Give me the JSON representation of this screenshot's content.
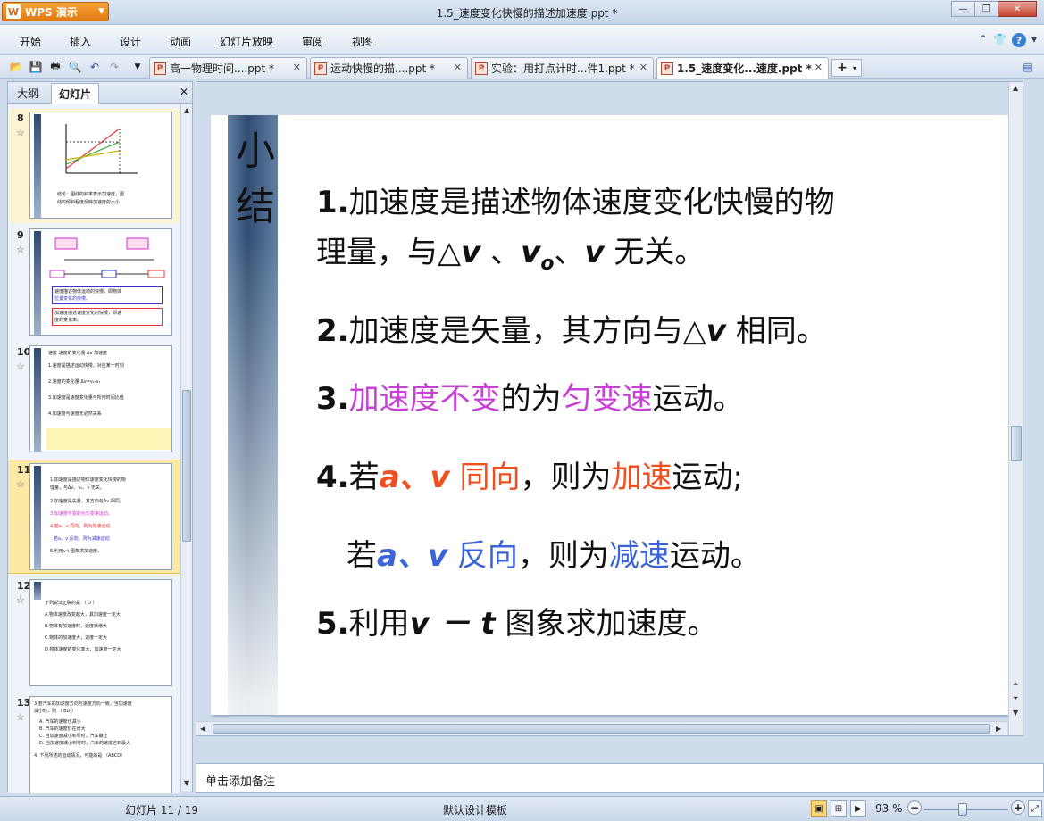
{
  "window": {
    "app_button": "WPS 演示",
    "app_logo": "W",
    "title": "1.5_速度变化快慢的描述加速度.ppt *",
    "controls": [
      "minimize-icon",
      "restore-icon",
      "close-icon"
    ]
  },
  "menu": [
    "开始",
    "插入",
    "设计",
    "动画",
    "幻灯片放映",
    "审阅",
    "视图"
  ],
  "tabs": [
    {
      "label": "高一物理时间....ppt *"
    },
    {
      "label": "运动快慢的描....ppt *"
    },
    {
      "label": "实验：用打点计时...件1.ppt *"
    },
    {
      "label": "1.5_速度变化...速度.ppt *"
    }
  ],
  "left_panel": {
    "tabs": [
      "大纲",
      "幻灯片"
    ],
    "slides": [
      {
        "num": "8",
        "lines": [
          "结论：图线的斜率表示加速度，图",
          "线的倾斜程度反映加速度的大小"
        ]
      },
      {
        "num": "9",
        "lines": [
          "速度描述物体运动的快慢，即物体",
          "位置变化的快慢。",
          "加速度描述速度变化的快慢，即速",
          "度的变化率。"
        ]
      },
      {
        "num": "10",
        "lines": [
          "速度      速度的变化量 Δv     加速度",
          "1.速度是描述运动快慢，对应某一时刻",
          "2.速度的变化量 Δv=v₂-v₁",
          "3.加速度是速度变化量与所用时间比值",
          "4.加速度与速度无必然关系"
        ]
      },
      {
        "num": "11",
        "lines": [
          "1.加速度是描述物体速度变化快慢的物",
          "理量，与Δv、v₀、v 无关。",
          "2.加速度是矢量，其方向与Δv 相同。",
          "3.加速度不变的为匀变速运动。",
          "4.若a、v 同向，则为加速运动",
          "若a、v 反向，则为减速运动",
          "5.利用v-t 图象求加速度。"
        ]
      },
      {
        "num": "12",
        "lines": [
          "下列说法正确的是         （ D ）",
          "A.物体速度改变越大，其加速度一定大",
          "B.物体有加速度时，速度就增大",
          "C.物体的加速度大，速度一定大",
          "D.物体速度的变化率大，加速度一定大"
        ]
      },
      {
        "num": "13",
        "lines": [
          "3.若汽车的加速度方向与速度方向一致，当加速度",
          "减小时，则                    （ BD ）",
          "A. 汽车的速度也减小",
          "B. 汽车的速度仍在增大",
          "C. 当加速度减小到零时，汽车静止",
          "D. 当加速度减小到零时，汽车的速度达到最大",
          "4. 下列所述的运动情况，可能的是    （ABCD）"
        ]
      }
    ]
  },
  "slide": {
    "side_title": "小结",
    "l1_num": "1.",
    "l1_text": "加速度是描述物体速度变化快慢的物",
    "l2_text": "理量，与△",
    "l2_v1": "v",
    "l2_sep1": " 、",
    "l2_v0": "v",
    "l2_v0_sub": "o",
    "l2_sep2": "、",
    "l2_v": "v",
    "l2_end": " 无关。",
    "l3_num": "2.",
    "l3_text": "加速度是矢量，其方向与△",
    "l3_v": "v",
    "l3_end": " 相同。",
    "l4_num": "3.",
    "l4_hl1": "加速度不变",
    "l4_mid": "的为",
    "l4_hl2": "匀变速",
    "l4_end": "运动。",
    "l5_num": "4.",
    "l5_pre": "若",
    "l5_av": "a、v",
    "l5_dir": " 同向",
    "l5_mid": "，则为",
    "l5_hl": "加速",
    "l5_end": "运动;",
    "l6_pre": "若",
    "l6_av": "a、v",
    "l6_dir": " 反向",
    "l6_mid": "，则为",
    "l6_hl": "减速",
    "l6_end": "运动。",
    "l7_num": "5.",
    "l7_pre": "利用",
    "l7_vt": "v － t",
    "l7_end": " 图象求加速度。"
  },
  "notes_placeholder": "单击添加备注",
  "status": {
    "slide_info": "幻灯片 11 / 19",
    "template": "默认设计模板",
    "zoom": "93 %",
    "zoom_fraction": 0.93
  },
  "colors": {
    "purple": "#c83fd6",
    "red": "#f05020",
    "blue": "#3c64d6",
    "side_bar": "#324d72"
  }
}
